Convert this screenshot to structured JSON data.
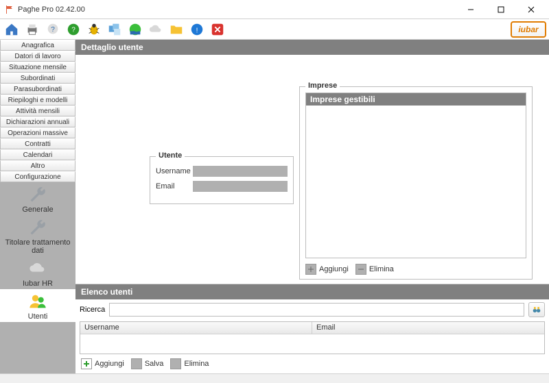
{
  "window": {
    "title": "Paghe Pro 02.42.00"
  },
  "toolbar": {
    "icons": [
      "home",
      "print",
      "help-bubble",
      "help",
      "bug",
      "multi-window",
      "world",
      "cloud",
      "folder",
      "info",
      "close"
    ],
    "brand": "iubar"
  },
  "sidebar": {
    "items": [
      "Anagrafica",
      "Datori di lavoro",
      "Situazione mensile",
      "Subordinati",
      "Parasubordinati",
      "Riepiloghi e modelli",
      "Attività mensili",
      "Dichiarazioni annuali",
      "Operazioni massive",
      "Contratti",
      "Calendari",
      "Altro",
      "Configurazione"
    ],
    "config_items": [
      {
        "label": "Generale",
        "icon": "wrench"
      },
      {
        "label": "Titolare trattamento dati",
        "icon": "wrench"
      },
      {
        "label": "Iubar HR",
        "icon": "cloud"
      },
      {
        "label": "Utenti",
        "icon": "users"
      }
    ],
    "active_config_index": 3
  },
  "detail": {
    "heading": "Dettaglio utente",
    "utente": {
      "legend": "Utente",
      "username_label": "Username",
      "email_label": "Email",
      "username_value": "",
      "email_value": ""
    },
    "imprese": {
      "legend": "Imprese",
      "list_header": "Imprese gestibili",
      "aggiungi_label": "Aggiungi",
      "elimina_label": "Elimina"
    }
  },
  "list": {
    "heading": "Elenco utenti",
    "search_label": "Ricerca",
    "search_value": "",
    "columns": [
      "Username",
      "Email"
    ],
    "rows": [],
    "aggiungi_label": "Aggiungi",
    "salva_label": "Salva",
    "elimina_label": "Elimina"
  }
}
